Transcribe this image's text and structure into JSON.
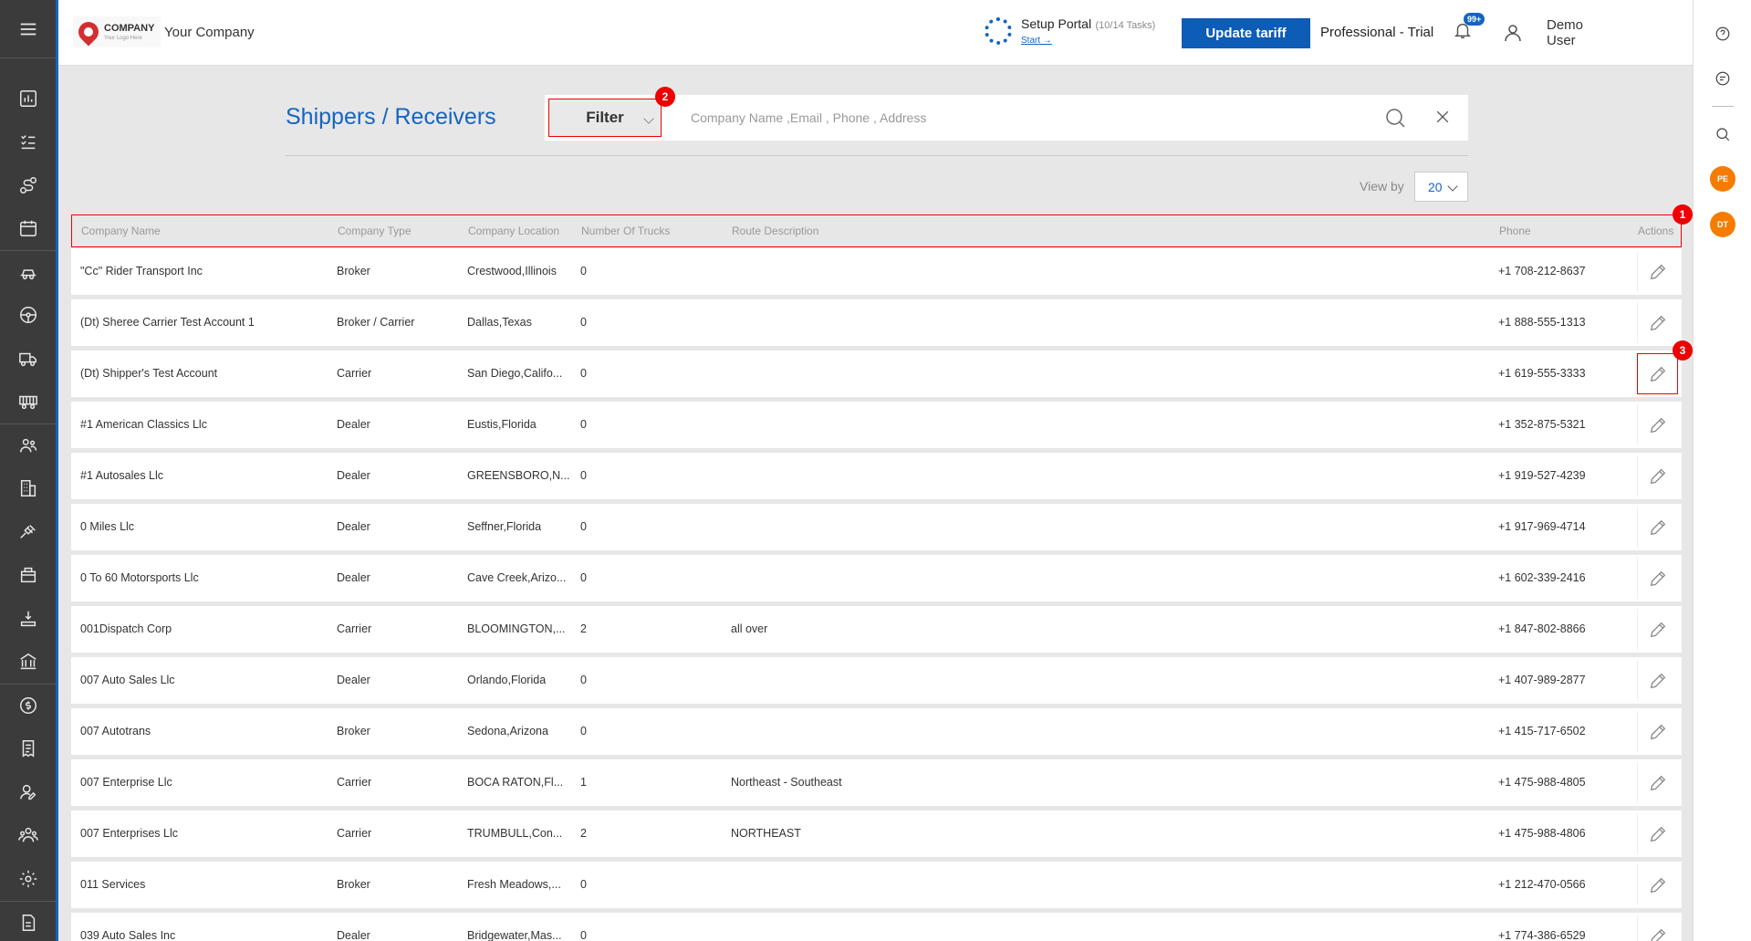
{
  "header": {
    "logo_line1": "COMPANY",
    "logo_line2": "Your Logo Here",
    "company_name": "Your Company",
    "setup_title": "Setup Portal",
    "setup_tasks": "(10/14 Tasks)",
    "setup_start": "Start →",
    "update_button": "Update tariff",
    "plan": "Professional - Trial",
    "notification_count": "99+",
    "user_name": "Demo User"
  },
  "rightbar": {
    "avatar1": "PE",
    "avatar2": "DT"
  },
  "page": {
    "title": "Shippers / Receivers",
    "filter_label": "Filter",
    "search_placeholder": "Company Name ,Email , Phone , Address",
    "view_by_label": "View by",
    "view_by_value": "20"
  },
  "badges": {
    "b1": "1",
    "b2": "2",
    "b3": "3"
  },
  "table": {
    "columns": {
      "company_name": "Company Name",
      "company_type": "Company Type",
      "company_location": "Company Location",
      "number_of_trucks": "Number Of Trucks",
      "route_description": "Route Description",
      "phone": "Phone",
      "actions": "Actions"
    },
    "rows": [
      {
        "name": "\"Cc\" Rider Transport Inc",
        "type": "Broker",
        "location": "Crestwood,Illinois",
        "trucks": "0",
        "route": "",
        "phone": "+1 708-212-8637"
      },
      {
        "name": "(Dt) Sheree Carrier Test Account 1",
        "type": "Broker / Carrier",
        "location": "Dallas,Texas",
        "trucks": "0",
        "route": "",
        "phone": "+1 888-555-1313"
      },
      {
        "name": "(Dt) Shipper's Test Account",
        "type": "Carrier",
        "location": "San Diego,Califo...",
        "trucks": "0",
        "route": "",
        "phone": "+1 619-555-3333"
      },
      {
        "name": "#1 American Classics Llc",
        "type": "Dealer",
        "location": "Eustis,Florida",
        "trucks": "0",
        "route": "",
        "phone": "+1 352-875-5321"
      },
      {
        "name": "#1 Autosales Llc",
        "type": "Dealer",
        "location": "GREENSBORO,N...",
        "trucks": "0",
        "route": "",
        "phone": "+1 919-527-4239"
      },
      {
        "name": "0 Miles Llc",
        "type": "Dealer",
        "location": "Seffner,Florida",
        "trucks": "0",
        "route": "",
        "phone": "+1 917-969-4714"
      },
      {
        "name": "0 To 60 Motorsports Llc",
        "type": "Dealer",
        "location": "Cave Creek,Arizo...",
        "trucks": "0",
        "route": "",
        "phone": "+1 602-339-2416"
      },
      {
        "name": "001Dispatch Corp",
        "type": "Carrier",
        "location": "BLOOMINGTON,...",
        "trucks": "2",
        "route": "all over",
        "phone": "+1 847-802-8866"
      },
      {
        "name": "007 Auto Sales Llc",
        "type": "Dealer",
        "location": "Orlando,Florida",
        "trucks": "0",
        "route": "",
        "phone": "+1 407-989-2877"
      },
      {
        "name": "007 Autotrans",
        "type": "Broker",
        "location": "Sedona,Arizona",
        "trucks": "0",
        "route": "",
        "phone": "+1 415-717-6502"
      },
      {
        "name": "007 Enterprise Llc",
        "type": "Carrier",
        "location": "BOCA RATON,Fl...",
        "trucks": "1",
        "route": "Northeast - Southeast",
        "phone": "+1 475-988-4805"
      },
      {
        "name": "007 Enterprises Llc",
        "type": "Carrier",
        "location": "TRUMBULL,Con...",
        "trucks": "2",
        "route": "NORTHEAST",
        "phone": "+1 475-988-4806"
      },
      {
        "name": "011 Services",
        "type": "Broker",
        "location": "Fresh Meadows,...",
        "trucks": "0",
        "route": "",
        "phone": "+1 212-470-0566"
      },
      {
        "name": "039 Auto Sales Inc",
        "type": "Dealer",
        "location": "Bridgewater,Mas...",
        "trucks": "0",
        "route": "",
        "phone": "+1 774-386-6529"
      }
    ]
  }
}
